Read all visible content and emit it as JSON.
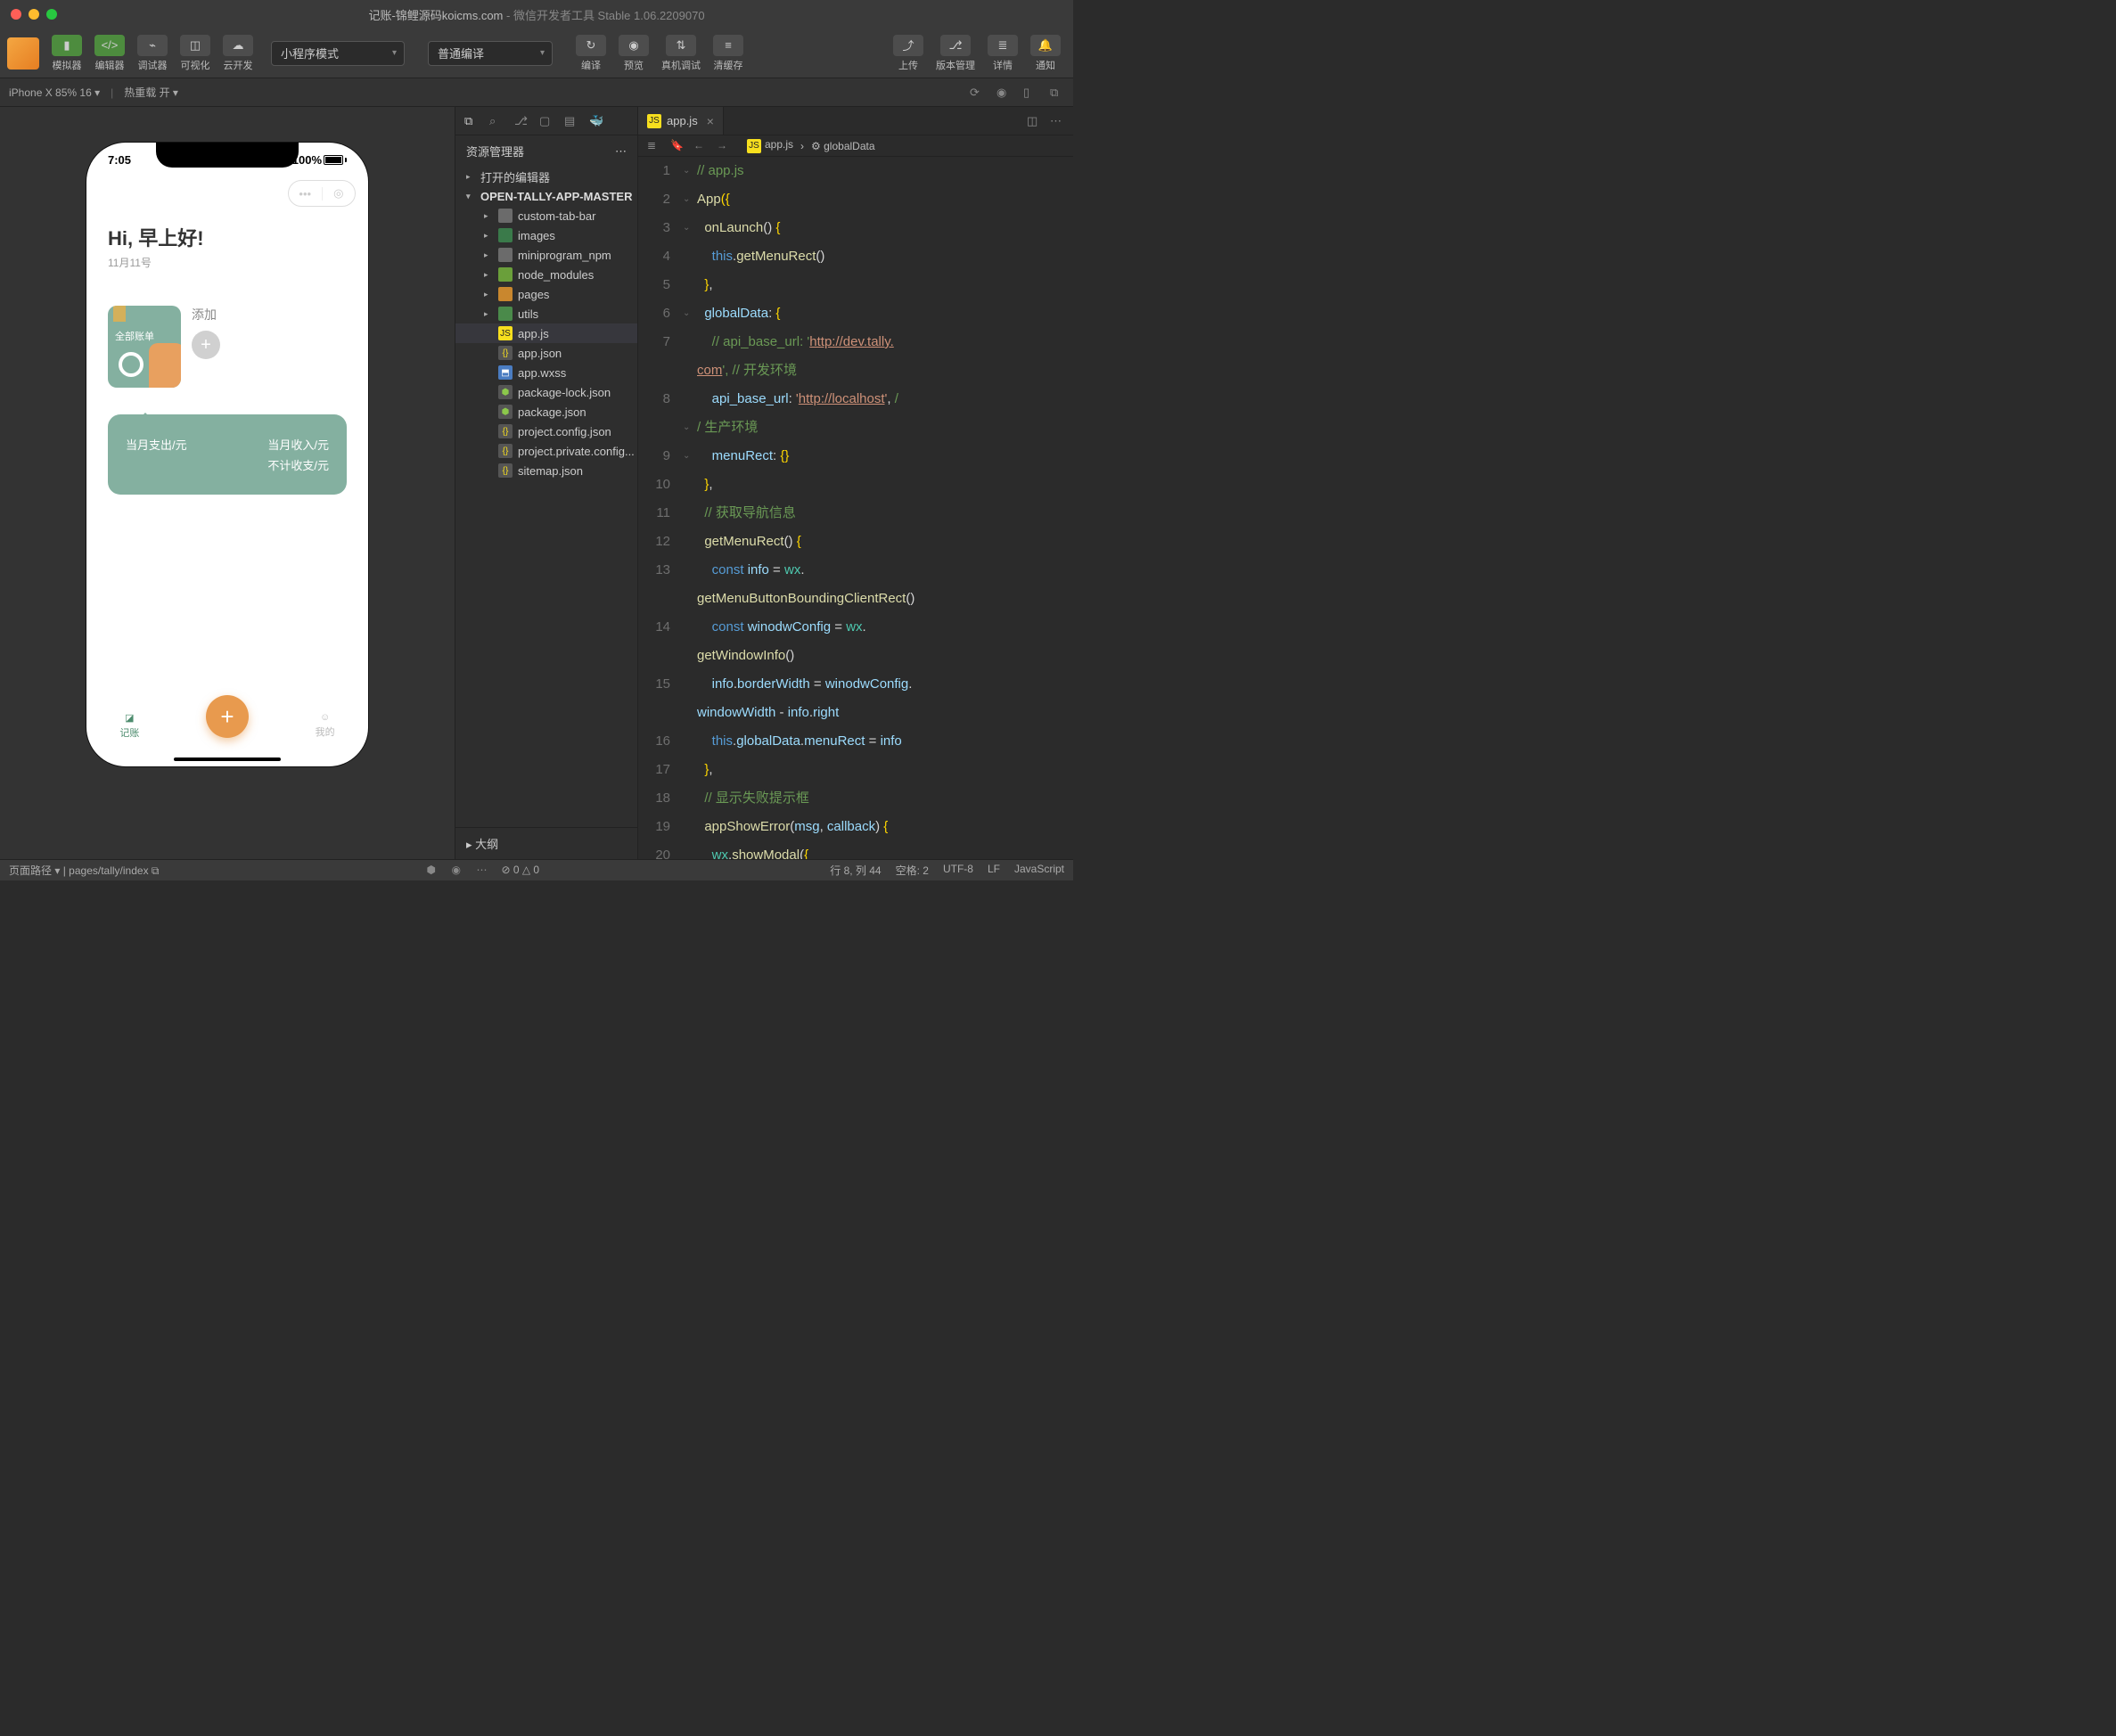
{
  "window": {
    "title_main": "记账-锦鲤源码koicms.com",
    "title_sub": " - 微信开发者工具 Stable 1.06.2209070"
  },
  "toolbar": {
    "simulator": "模拟器",
    "editor": "编辑器",
    "debugger": "调试器",
    "visualize": "可视化",
    "cloud": "云开发",
    "mode": "小程序模式",
    "compile_mode": "普通编译",
    "compile": "编译",
    "preview": "预览",
    "realdebug": "真机调试",
    "clearcache": "清缓存",
    "upload": "上传",
    "version": "版本管理",
    "detail": "详情",
    "notice": "通知"
  },
  "subbar": {
    "device": "iPhone X 85% 16",
    "reload": "热重载 开"
  },
  "explorer": {
    "title": "资源管理器",
    "open_editors": "打开的编辑器",
    "root": "OPEN-TALLY-APP-MASTER",
    "items": [
      {
        "label": "custom-tab-bar",
        "icon": "folder",
        "indent": 2,
        "chev": "▸"
      },
      {
        "label": "images",
        "icon": "folderimg",
        "indent": 2,
        "chev": "▸"
      },
      {
        "label": "miniprogram_npm",
        "icon": "folder",
        "indent": 2,
        "chev": "▸"
      },
      {
        "label": "node_modules",
        "icon": "foldernode",
        "indent": 2,
        "chev": "▸"
      },
      {
        "label": "pages",
        "icon": "folderpages",
        "indent": 2,
        "chev": "▸"
      },
      {
        "label": "utils",
        "icon": "folderutils",
        "indent": 2,
        "chev": "▸"
      },
      {
        "label": "app.js",
        "icon": "js",
        "indent": 2,
        "sel": true
      },
      {
        "label": "app.json",
        "icon": "json",
        "indent": 2
      },
      {
        "label": "app.wxss",
        "icon": "wxss",
        "indent": 2
      },
      {
        "label": "package-lock.json",
        "icon": "npm",
        "indent": 2
      },
      {
        "label": "package.json",
        "icon": "npm",
        "indent": 2
      },
      {
        "label": "project.config.json",
        "icon": "json",
        "indent": 2
      },
      {
        "label": "project.private.config...",
        "icon": "json",
        "indent": 2
      },
      {
        "label": "sitemap.json",
        "icon": "json",
        "indent": 2
      }
    ],
    "outline": "大纲"
  },
  "editor": {
    "tab_file": "app.js",
    "bc_file": "app.js",
    "bc_symbol": "globalData",
    "lines": [
      {
        "n": 1,
        "html": "<span class='c-comment'>// app.js</span>"
      },
      {
        "n": 2,
        "fold": "⌄",
        "html": "<span class='c-func'>App</span><span class='c-punc'>({</span>"
      },
      {
        "n": 3,
        "fold": "⌄",
        "html": "  <span class='c-func'>onLaunch</span>() <span class='c-punc'>{</span>"
      },
      {
        "n": 4,
        "html": "    <span class='c-kw'>this</span>.<span class='c-func'>getMenuRect</span>()"
      },
      {
        "n": 5,
        "html": "  <span class='c-punc'>}</span>,"
      },
      {
        "n": 6,
        "fold": "⌄",
        "html": "  <span class='c-key'>globalData</span>: <span class='c-punc'>{</span>"
      },
      {
        "n": 7,
        "html": "    <span class='c-comment'>// api_base_url: '<span class='c-link'>http://dev.tally.</span></span>\n<span class='c-comment'><span class='c-link'>com</span>', // 开发环境</span>"
      },
      {
        "n": 8,
        "hl": true,
        "html": "    <span class='c-key'>api_base_url</span>: <span class='c-str'>'<span class='c-link'>http://localhost</span>'</span>, <span class='c-comment'>/</span>\n<span class='c-comment'>/ 生产环境</span>"
      },
      {
        "n": 9,
        "html": "    <span class='c-key'>menuRect</span>: <span class='c-punc'>{}</span>"
      },
      {
        "n": 10,
        "html": "  <span class='c-punc'>}</span>,"
      },
      {
        "n": 11,
        "html": "  <span class='c-comment'>// 获取导航信息</span>"
      },
      {
        "n": 12,
        "fold": "⌄",
        "html": "  <span class='c-func'>getMenuRect</span>() <span class='c-punc'>{</span>"
      },
      {
        "n": 13,
        "html": "    <span class='c-kw'>const</span> <span class='c-key'>info</span> = <span class='c-id'>wx</span>.\n<span class='c-func'>getMenuButtonBoundingClientRect</span>()"
      },
      {
        "n": 14,
        "html": "    <span class='c-kw'>const</span> <span class='c-key'>winodwConfig</span> = <span class='c-id'>wx</span>.\n<span class='c-func'>getWindowInfo</span>()"
      },
      {
        "n": 15,
        "html": "    <span class='c-key'>info</span>.<span class='c-key'>borderWidth</span> = <span class='c-key'>winodwConfig</span>.\n<span class='c-key'>windowWidth</span> - <span class='c-key'>info</span>.<span class='c-key'>right</span>"
      },
      {
        "n": 16,
        "html": "    <span class='c-kw'>this</span>.<span class='c-key'>globalData</span>.<span class='c-key'>menuRect</span> = <span class='c-key'>info</span>"
      },
      {
        "n": 17,
        "html": "  <span class='c-punc'>}</span>,"
      },
      {
        "n": 18,
        "html": "  <span class='c-comment'>// 显示失败提示框</span>"
      },
      {
        "n": 19,
        "fold": "⌄",
        "html": "  <span class='c-func'>appShowError</span>(<span class='c-key'>msg</span>, <span class='c-key'>callback</span>) <span class='c-punc'>{</span>"
      },
      {
        "n": 20,
        "fold": "⌄",
        "html": "    <span class='c-id'>wx</span>.<span class='c-func'>showModal</span>(<span class='c-punc'>{</span>"
      }
    ]
  },
  "status": {
    "page_path_label": "页面路径",
    "page_path": "pages/tally/index",
    "errors": "⊘ 0 △ 0",
    "pos": "行 8, 列 44",
    "spaces": "空格: 2",
    "enc": "UTF-8",
    "eol": "LF",
    "lang": "JavaScript"
  },
  "phone": {
    "time": "7:05",
    "battery": "100%",
    "greeting": "Hi, 早上好!",
    "date": "11月11号",
    "all_bills": "全部账单",
    "add": "添加",
    "expense": "当月支出/元",
    "income": "当月收入/元",
    "ignore": "不计收支/元",
    "tab_tally": "记账",
    "tab_mine": "我的"
  }
}
